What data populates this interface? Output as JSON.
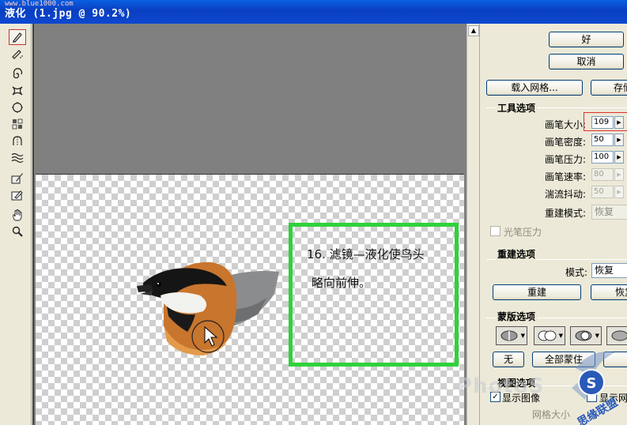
{
  "window": {
    "title": "液化 (1.jpg @ 90.2%)",
    "site_watermark": "www.blue1000.com"
  },
  "toolbar": {
    "tools": [
      "warp-icon",
      "reconstruct-icon",
      "twirl-clockwise-icon",
      "pucker-icon",
      "bloat-icon",
      "push-left-icon",
      "mirror-icon",
      "turbulence-icon",
      "freeze-mask-icon",
      "thaw-mask-icon",
      "hand-icon",
      "zoom-icon"
    ]
  },
  "annotation": {
    "line1": "16. 滤镜—液化使鸟头",
    "line2": "略向前伸。",
    "color": "#2fd23a"
  },
  "panel": {
    "ok_label": "好",
    "cancel_label": "取消",
    "load_mesh_label": "载入网格...",
    "save_mesh_label": "存储",
    "tool_options": {
      "title": "工具选项",
      "brush_size_label": "画笔大小:",
      "brush_size": "109",
      "brush_density_label": "画笔密度:",
      "brush_density": "50",
      "brush_pressure_label": "画笔压力:",
      "brush_pressure": "100",
      "brush_rate_label": "画笔速率:",
      "brush_rate": "80",
      "turbulent_jitter_label": "湍流抖动:",
      "turbulent_jitter": "50",
      "reconstruct_mode_label": "重建模式:",
      "reconstruct_mode": "恢复",
      "stylus_pressure_label": "光笔压力"
    },
    "reconstruct_options": {
      "title": "重建选项",
      "mode_label": "模式:",
      "mode": "恢复",
      "reconstruct_label": "重建",
      "restore_label": "恢复"
    },
    "mask_options": {
      "title": "蒙版选项",
      "none_label": "无",
      "mask_all_label": "全部蒙住"
    },
    "view_options": {
      "title": "视图选项",
      "show_image_label": "显示图像",
      "show_mesh_label": "显示网",
      "mesh_size_label": "网格大小"
    }
  },
  "watermarks": {
    "photoshop": "PhotoS",
    "logo_text": "思缘联盟"
  }
}
